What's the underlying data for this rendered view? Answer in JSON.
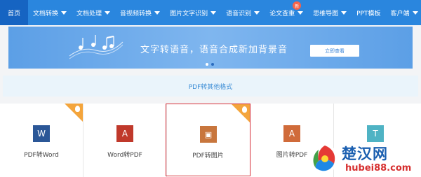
{
  "nav": {
    "items": [
      {
        "label": "首页",
        "active": true,
        "caret": false
      },
      {
        "label": "文档转换",
        "caret": true
      },
      {
        "label": "文档处理",
        "caret": true
      },
      {
        "label": "音视频转换",
        "caret": true
      },
      {
        "label": "图片文字识别",
        "caret": true
      },
      {
        "label": "语音识别",
        "caret": true
      },
      {
        "label": "论文查重",
        "caret": true,
        "badge": "新"
      },
      {
        "label": "思维导图",
        "caret": true
      },
      {
        "label": "PPT模板",
        "caret": false
      },
      {
        "label": "客户端",
        "caret": true
      }
    ]
  },
  "banner": {
    "text": "文字转语音，语音合成新加背景音",
    "button": "立即查看"
  },
  "section": {
    "title": "PDF转其他格式"
  },
  "cards": [
    {
      "label": "PDF转Word",
      "icon": "word-icon",
      "icon_letter": "W",
      "icon_color": "#2b5797",
      "hot": true
    },
    {
      "label": "Word转PDF",
      "icon": "pdf-icon",
      "icon_letter": "A",
      "icon_color": "#c0392b",
      "hot": false
    },
    {
      "label": "PDF转图片",
      "icon": "image-icon",
      "icon_letter": "▣",
      "icon_color": "#c8763d",
      "hot": true,
      "selected": true
    },
    {
      "label": "图片转PDF",
      "icon": "pdf-icon",
      "icon_letter": "A",
      "icon_color": "#d06b3a",
      "hot": false
    },
    {
      "label": "",
      "icon": "text-icon",
      "icon_letter": "T",
      "icon_color": "#4fb3c4",
      "hot": false
    }
  ],
  "watermark": {
    "title": "楚汉网",
    "url": "hubei88.com"
  },
  "colors": {
    "nav": "#2a86de",
    "nav_active": "#1664c2",
    "highlight": "#d7313a",
    "hot_corner": "#f4a53c"
  }
}
